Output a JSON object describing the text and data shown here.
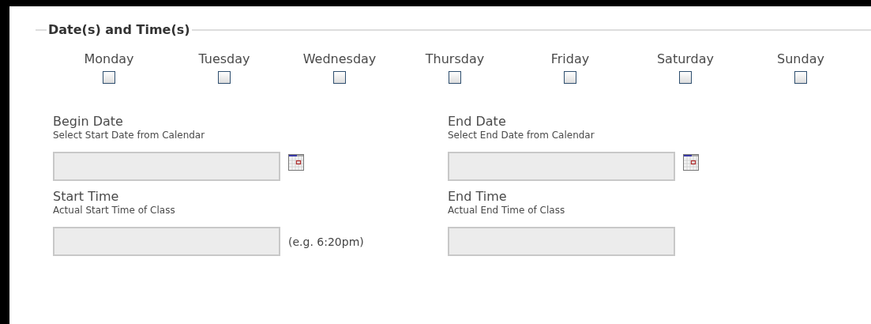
{
  "section": {
    "title": "Date(s) and Time(s)"
  },
  "days": [
    {
      "label": "Monday",
      "checked": false
    },
    {
      "label": "Tuesday",
      "checked": false
    },
    {
      "label": "Wednesday",
      "checked": false
    },
    {
      "label": "Thursday",
      "checked": false
    },
    {
      "label": "Friday",
      "checked": false
    },
    {
      "label": "Saturday",
      "checked": false
    },
    {
      "label": "Sunday",
      "checked": false
    }
  ],
  "fields": [
    {
      "kind": "date",
      "label": "Begin Date",
      "hint": "Select Start Date from Calendar"
    },
    {
      "kind": "date",
      "label": "End Date",
      "hint": "Select End Date from Calendar"
    },
    {
      "kind": "time",
      "label": "Start Time",
      "hint": "Actual Start Time of Class",
      "note": "(e.g. 6:20pm)"
    },
    {
      "kind": "time",
      "label": "End Time",
      "hint": "Actual End Time of Class"
    }
  ]
}
